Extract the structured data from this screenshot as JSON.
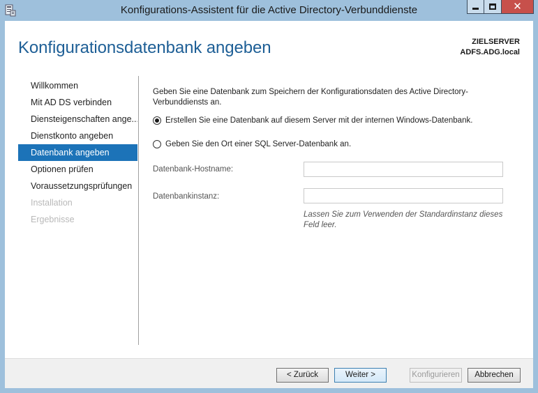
{
  "window": {
    "title": "Konfigurations-Assistent für die Active Directory-Verbunddienste",
    "icons": {
      "app": "server-wizard-icon",
      "minimize": "minimize-icon",
      "maximize": "maximize-icon",
      "close": "close-icon"
    },
    "close_color": "#c7504b"
  },
  "header": {
    "page_title": "Konfigurationsdatenbank angeben",
    "target_label": "ZIELSERVER",
    "target_server": "ADFS.ADG.local"
  },
  "nav": {
    "items": [
      {
        "label": "Willkommen",
        "state": "normal"
      },
      {
        "label": "Mit AD DS verbinden",
        "state": "normal"
      },
      {
        "label": "Diensteigenschaften ange...",
        "state": "normal"
      },
      {
        "label": "Dienstkonto angeben",
        "state": "normal"
      },
      {
        "label": "Datenbank angeben",
        "state": "active"
      },
      {
        "label": "Optionen prüfen",
        "state": "normal"
      },
      {
        "label": "Voraussetzungsprüfungen",
        "state": "normal"
      },
      {
        "label": "Installation",
        "state": "disabled"
      },
      {
        "label": "Ergebnisse",
        "state": "disabled"
      }
    ],
    "active_color": "#1c73b8"
  },
  "content": {
    "description": "Geben Sie eine Datenbank zum Speichern der Konfigurationsdaten des Active Directory-Verbunddiensts an.",
    "option_internal": "Erstellen Sie eine Datenbank auf diesem Server mit der internen Windows-Datenbank.",
    "option_sql": "Geben Sie den Ort einer SQL Server-Datenbank an.",
    "selected_option": "internal",
    "hostname_label": "Datenbank-Hostname:",
    "hostname_value": "",
    "instance_label": "Datenbankinstanz:",
    "instance_value": "",
    "instance_hint": "Lassen Sie zum Verwenden der Standardinstanz dieses Feld leer."
  },
  "footer": {
    "back_label": "< Zurück",
    "next_label": "Weiter >",
    "configure_label": "Konfigurieren",
    "cancel_label": "Abbrechen"
  }
}
